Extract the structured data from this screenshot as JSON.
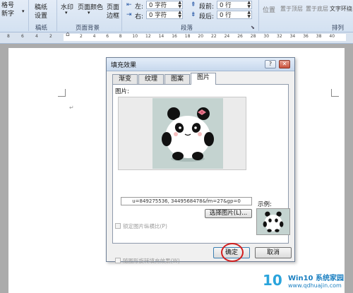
{
  "ribbon": {
    "left_top": "格号",
    "left_bottom": "新字",
    "btn_manuscript_1": "稿纸",
    "btn_manuscript_2": "设置",
    "btn_watermark": "水印",
    "btn_page_color": "页面颜色",
    "btn_page_border_1": "页面",
    "btn_page_border_2": "边框",
    "indent_left_label": "左:",
    "indent_left_value": "0 字符",
    "indent_right_label": "右:",
    "indent_right_value": "0 字符",
    "spacing_before_label": "段前:",
    "spacing_before_value": "0 行",
    "spacing_after_label": "段后:",
    "spacing_after_value": "0 行",
    "btn_position": "位置",
    "btn_bring_front": "置于顶层",
    "btn_send_back": "置于底层",
    "btn_wrap": "文字环绕",
    "groups": {
      "manuscript": "稿纸",
      "page_background": "页面背景",
      "paragraph": "段落",
      "arrange": "排列"
    }
  },
  "ruler": {
    "ticks_left": [
      "8",
      "6",
      "4",
      "2"
    ],
    "ticks_right": [
      "2",
      "4",
      "6",
      "8",
      "10",
      "12",
      "14",
      "16",
      "18",
      "20",
      "22",
      "24",
      "26",
      "28",
      "30",
      "32",
      "34",
      "36",
      "38",
      "40"
    ]
  },
  "document": {
    "paragraph_mark": "↵"
  },
  "dialog": {
    "title": "填充效果",
    "help_button": "?",
    "close_button": "✕",
    "tabs": [
      "渐变",
      "纹理",
      "图案",
      "图片"
    ],
    "active_tab_index": 3,
    "picture_label": "图片:",
    "filename": "u=849275536, 3449568478&fm=27&gp=0",
    "select_picture_button": "选择图片(L)...",
    "lock_aspect_label": "锁定图片纵横比(P)",
    "rotate_with_shape_label": "随图形旋转填充效果(W)",
    "sample_label": "示例:",
    "ok_button": "确定",
    "cancel_button": "取消"
  },
  "watermark": {
    "logo": "10",
    "title": "Win10 系统家园",
    "url": "www.qdhuajin.com"
  },
  "colors": {
    "ribbon_bg": "#dbe6f4",
    "dialog_bg": "#f0f0f0",
    "preview_bg": "#c4d3d0",
    "highlight_circle": "#d21e1e",
    "brand_blue": "#1a7fc1"
  }
}
